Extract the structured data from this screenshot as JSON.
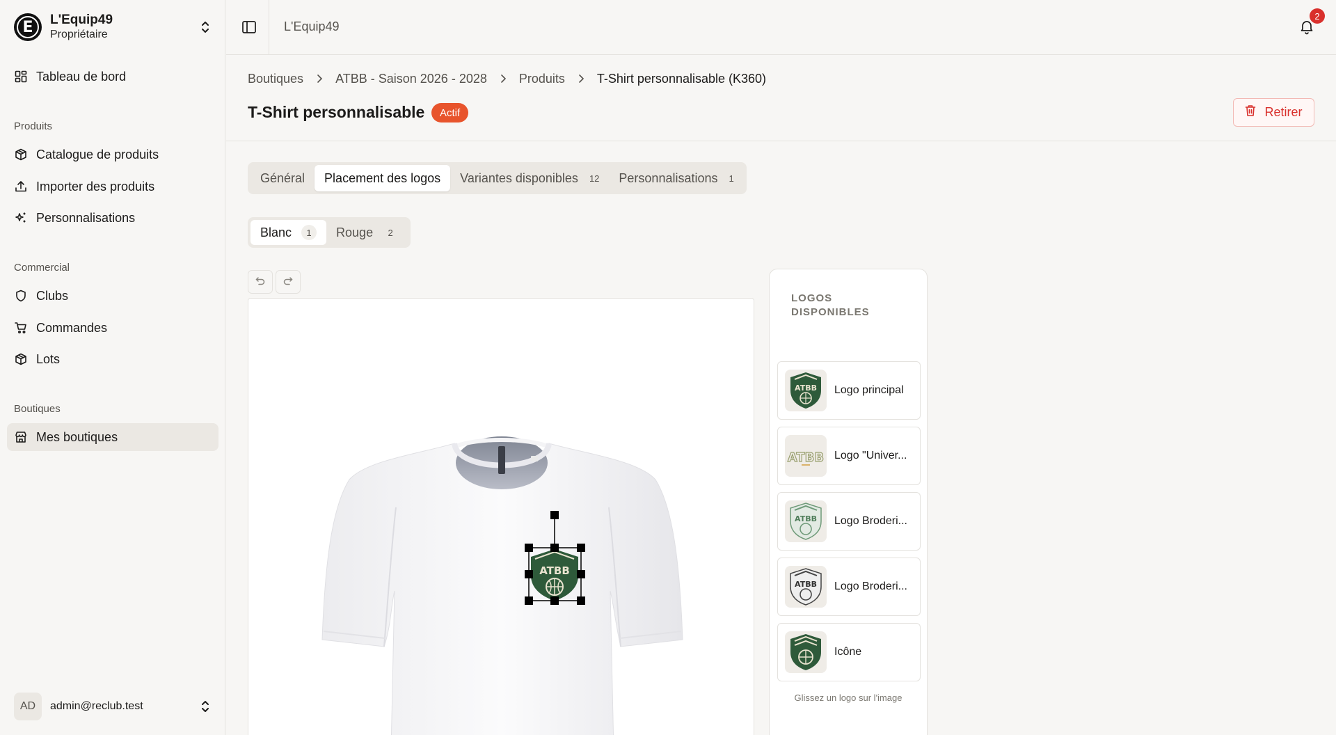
{
  "org": {
    "name": "L'Equip49",
    "role": "Propriétaire",
    "logo_letter": "E"
  },
  "nav": {
    "dashboard": "Tableau de bord",
    "section_products": "Produits",
    "catalogue": "Catalogue de produits",
    "import": "Importer des produits",
    "personalizations": "Personnalisations",
    "section_commercial": "Commercial",
    "clubs": "Clubs",
    "orders": "Commandes",
    "lots": "Lots",
    "section_shops": "Boutiques",
    "my_shops": "Mes boutiques"
  },
  "user": {
    "initials": "AD",
    "email": "admin@reclub.test"
  },
  "topbar": {
    "title": "L'Equip49",
    "notification_count": "2"
  },
  "breadcrumb": [
    "Boutiques",
    "ATBB - Saison 2026 - 2028",
    "Produits",
    "T-Shirt personnalisable (K360)"
  ],
  "page": {
    "title": "T-Shirt personnalisable",
    "status": "Actif",
    "remove_label": "Retirer"
  },
  "tabs": [
    {
      "label": "Général",
      "count": ""
    },
    {
      "label": "Placement des logos",
      "count": ""
    },
    {
      "label": "Variantes disponibles",
      "count": "12"
    },
    {
      "label": "Personnalisations",
      "count": "1"
    }
  ],
  "variants": [
    {
      "label": "Blanc",
      "count": "1"
    },
    {
      "label": "Rouge",
      "count": "2"
    }
  ],
  "logos_panel": {
    "title": "LOGOS DISPONIBLES",
    "items": [
      {
        "name": "Logo principal"
      },
      {
        "name": "Logo \"Univer..."
      },
      {
        "name": "Logo Broderi..."
      },
      {
        "name": "Logo Broderi..."
      },
      {
        "name": "Icône"
      }
    ],
    "hint": "Glissez un logo sur l'image"
  },
  "placed_logo": {
    "text": "ATBB"
  },
  "colors": {
    "accent": "#e8542c",
    "danger": "#d9302c",
    "logo_green": "#2e5a3a"
  }
}
